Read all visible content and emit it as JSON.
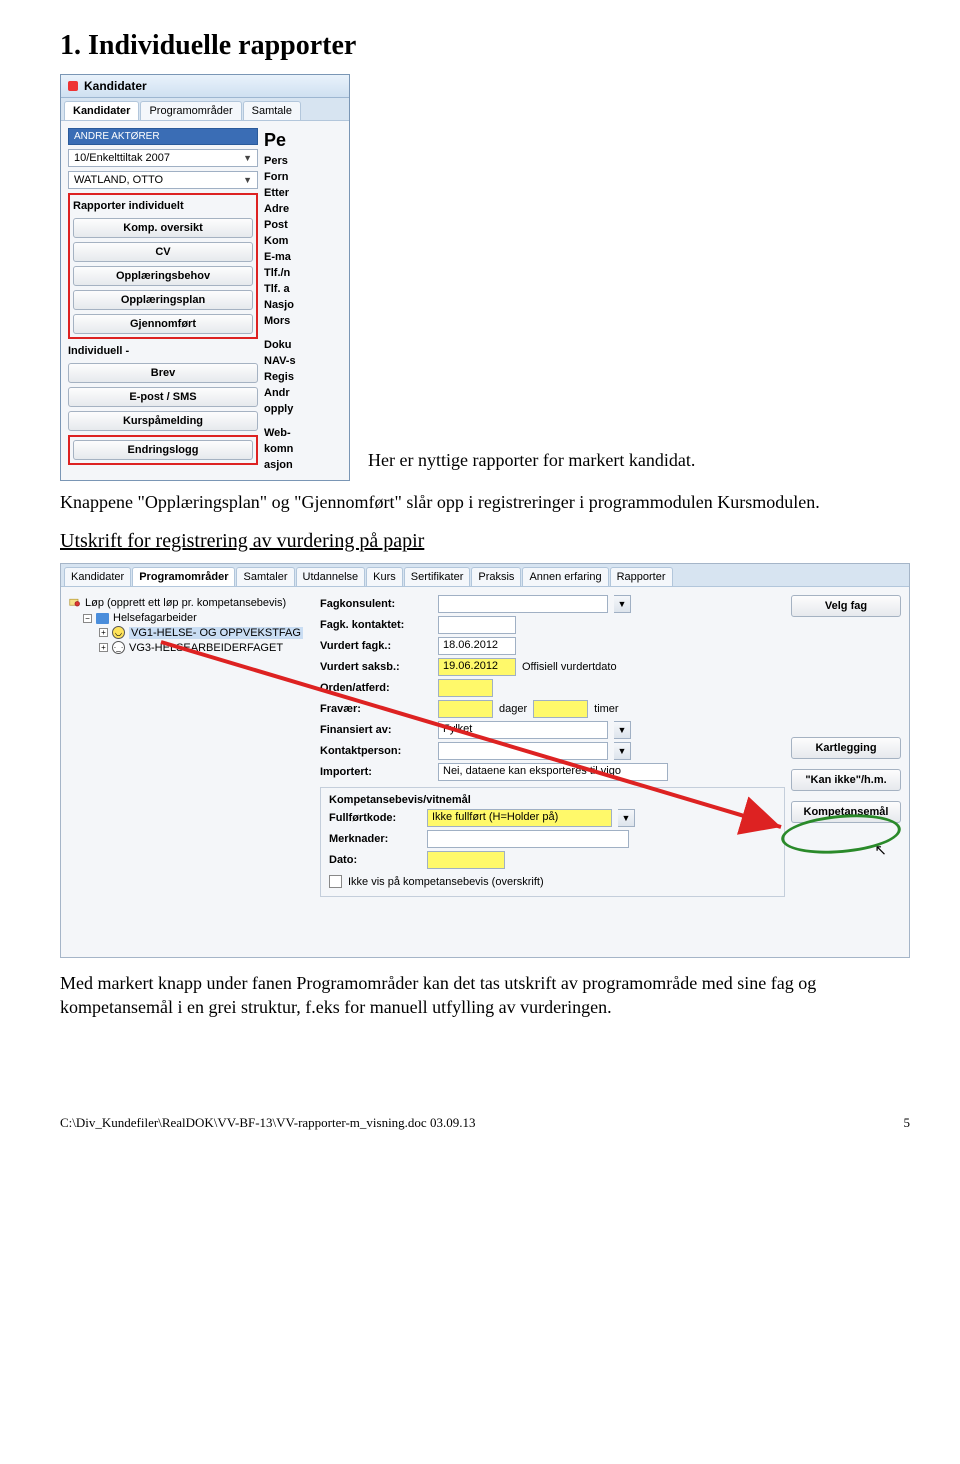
{
  "heading": "1. Individuelle rapporter",
  "intro_text": "Her er nyttige rapporter for markert kandidat.",
  "after_intro": "Knappene \"Opplæringsplan\" og \"Gjennomført\" slår opp i registreringer i programmodulen Kursmodulen.",
  "subheading": "Utskrift for registrering av vurdering på papir",
  "paragraph": "Med markert knapp under fanen Programområder kan det tas utskrift av programområde med sine fag og kompetansemål i en grei struktur, f.eks for manuell utfylling av vurderingen.",
  "footer": {
    "path": "C:\\Div_Kundefiler\\RealDOK\\VV-BF-13\\VV-rapporter-m_visning.doc   03.09.13",
    "page": "5"
  },
  "window1": {
    "title": "Kandidater",
    "tabs": [
      "Kandidater",
      "Programområder",
      "Samtale"
    ],
    "active_tab": 0,
    "sel_group": "ANDRE AKTØRER",
    "combo1": "10/Enkelttiltak 2007",
    "combo2": "WATLAND, OTTO",
    "section_report": "Rapporter individuelt",
    "buttons_report": [
      "Komp. oversikt",
      "CV",
      "Opplæringsbehov",
      "Opplæringsplan",
      "Gjennomført"
    ],
    "section_indiv": "Individuell -",
    "buttons_indiv": [
      "Brev",
      "E-post / SMS",
      "Kurspåmelding",
      "Endringslogg"
    ],
    "right_header": "Pe",
    "right_labels": [
      "Pers",
      "Forn",
      "Etter",
      "Adre",
      "Post",
      "Kom",
      "E-ma",
      "Tlf./n",
      "Tlf. a",
      "Nasjo",
      "Mors",
      "",
      "Doku",
      "NAV-s",
      "Regis",
      "Andr",
      "opply",
      "",
      "Web-",
      "komn",
      "asjon"
    ]
  },
  "window2": {
    "tabs": [
      "Kandidater",
      "Programområder",
      "Samtaler",
      "Utdannelse",
      "Kurs",
      "Sertifikater",
      "Praksis",
      "Annen erfaring",
      "Rapporter"
    ],
    "active_tab": 1,
    "tree_header": "Løp (opprett ett løp pr. kompetansebevis)",
    "tree_root": "Helsefagarbeider",
    "tree_items": [
      {
        "icon": "smile",
        "label": "VG1-HELSE- OG OPPVEKSTFAG",
        "selected": true
      },
      {
        "icon": "neutral",
        "label": "VG3-HELSEARBEIDERFAGET",
        "selected": false
      }
    ],
    "form": {
      "fagkonsulent_label": "Fagkonsulent:",
      "fagkonsulent": "",
      "kontaktet_label": "Fagk. kontaktet:",
      "kontaktet": "",
      "vurdert_fagk_label": "Vurdert fagk.:",
      "vurdert_fagk": "18.06.2012",
      "vurdert_saksb_label": "Vurdert saksb.:",
      "vurdert_saksb": "19.06.2012",
      "offisiell": "Offisiell vurdertdato",
      "orden_label": "Orden/atferd:",
      "orden": "",
      "fravaer_label": "Fravær:",
      "dager": "dager",
      "timer": "timer",
      "finans_label": "Finansiert av:",
      "finans": "Fylket",
      "kontakt_label": "Kontaktperson:",
      "kontakt": "",
      "import_label": "Importert:",
      "import_val": "Nei, dataene kan eksporteres til vigo",
      "inner_header": "Kompetansebevis/vitnemål",
      "fullfort_label": "Fullførtkode:",
      "fullfort": "Ikke fullført (H=Holder på)",
      "merk_label": "Merknader:",
      "dato_label": "Dato:",
      "checkbox_label": "Ikke vis på kompetansebevis (overskrift)"
    },
    "side_buttons": [
      "Velg fag",
      "Kartlegging",
      "\"Kan ikke\"/h.m.",
      "Kompetansemål"
    ]
  }
}
